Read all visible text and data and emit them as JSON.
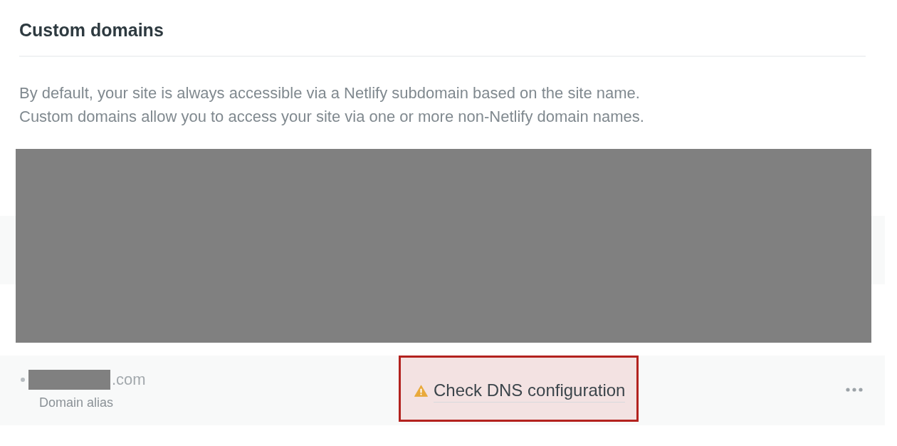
{
  "section": {
    "title": "Custom domains",
    "description": [
      "By default, your site is always accessible via a Netlify subdomain based on the site name.",
      "Custom domains allow you to access your site via one or more non-Netlify domain names."
    ]
  },
  "domains": [
    {
      "color": "#b8bdc1",
      "name_redacted": true,
      "name": ".com",
      "role": "Domain alias",
      "status": {
        "kind": "warning",
        "label": "Check DNS configuration",
        "highlighted": true
      }
    }
  ]
}
